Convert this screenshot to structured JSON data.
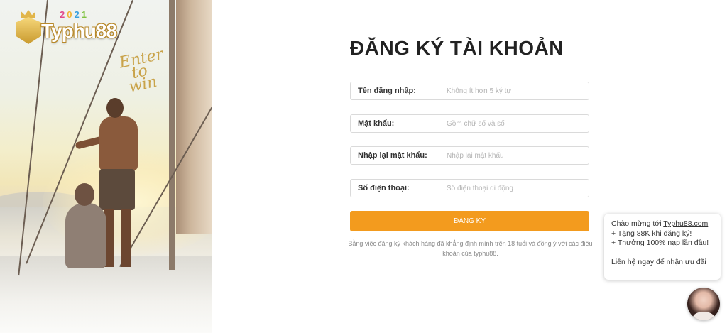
{
  "brand": {
    "name": "Typhu88",
    "year_digits": [
      "2",
      "0",
      "2",
      "1"
    ],
    "year_colors": [
      "#e04a8c",
      "#f2b233",
      "#3aa0e0",
      "#7fc241"
    ],
    "tagline_line1": "Enter",
    "tagline_line2": "to",
    "tagline_line3": "win",
    "accent": "#f39b1e"
  },
  "form": {
    "title": "ĐĂNG KÝ TÀI KHOẢN",
    "fields": [
      {
        "label": "Tên đăng nhập:",
        "placeholder": "Không ít hơn 5 ký tự",
        "value": ""
      },
      {
        "label": "Mật khẩu:",
        "placeholder": "Gồm chữ số và số",
        "value": ""
      },
      {
        "label": "Nhập lại mật khẩu:",
        "placeholder": "Nhập lại mật khẩu",
        "value": ""
      },
      {
        "label": "Số điện thoại:",
        "placeholder": "Số điện thoại di động",
        "value": ""
      }
    ],
    "submit_label": "ĐĂNG KÝ",
    "terms_line1": "Bằng việc đăng ký khách hàng đã khẳng định mình trên 18 tuổi và đồng ý với các điều",
    "terms_line2": "khoản của typhu88."
  },
  "chat": {
    "greeting_prefix": "Chào mừng tới ",
    "greeting_link": "Typhu88.com",
    "line2": "+ Tặng 88K khi đăng ký!",
    "line3": "+ Thưởng 100% nạp lần đầu!",
    "line4": "Liên hệ ngay để nhận ưu đãi"
  }
}
